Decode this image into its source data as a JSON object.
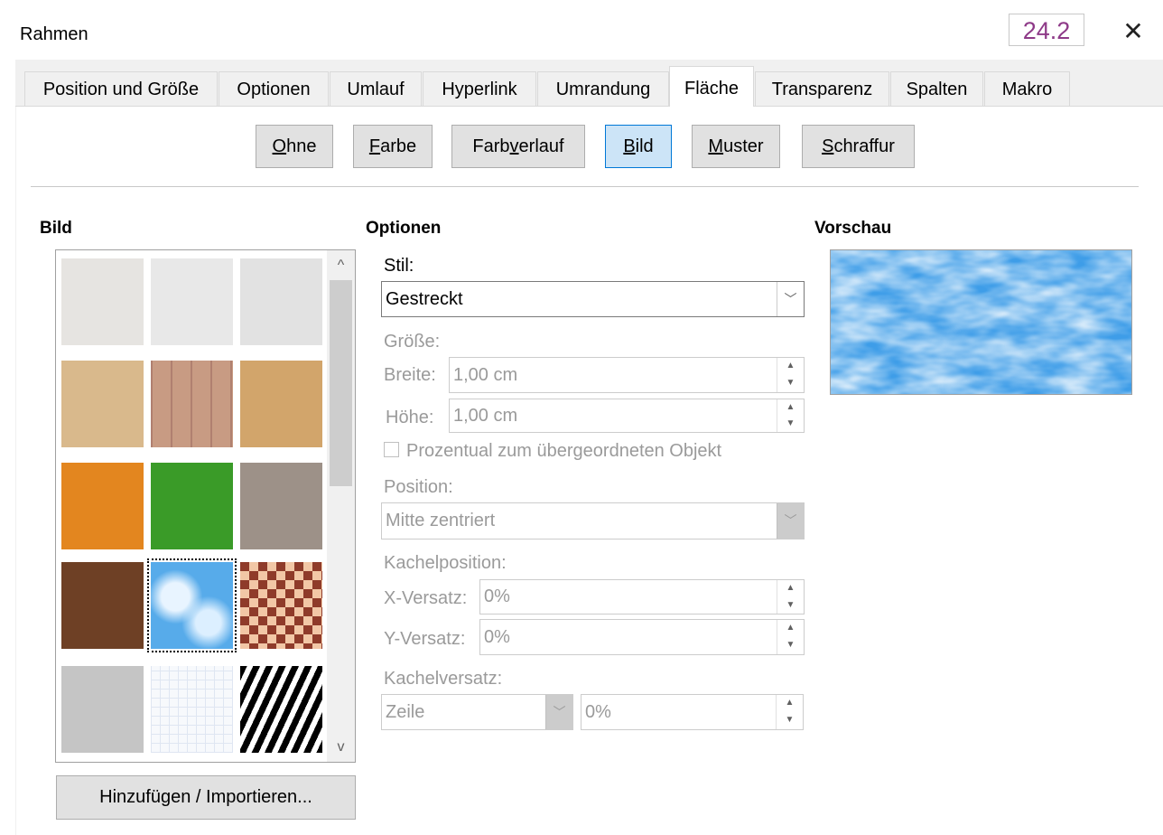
{
  "window": {
    "title": "Rahmen",
    "version": "24.2",
    "close_symbol": "✕"
  },
  "tabs": [
    {
      "label": "Position und Größe",
      "active": false
    },
    {
      "label": "Optionen",
      "active": false
    },
    {
      "label": "Umlauf",
      "active": false
    },
    {
      "label": "Hyperlink",
      "active": false
    },
    {
      "label": "Umrandung",
      "active": false
    },
    {
      "label": "Fläche",
      "active": true
    },
    {
      "label": "Transparenz",
      "active": false
    },
    {
      "label": "Spalten",
      "active": false
    },
    {
      "label": "Makro",
      "active": false
    }
  ],
  "fill_types": [
    {
      "label_pre": "",
      "label_u": "O",
      "label_post": "hne",
      "active": false
    },
    {
      "label_pre": "",
      "label_u": "F",
      "label_post": "arbe",
      "active": false
    },
    {
      "label_pre": "Farb",
      "label_u": "v",
      "label_post": "erlauf",
      "active": false
    },
    {
      "label_pre": "",
      "label_u": "B",
      "label_post": "ild",
      "active": true
    },
    {
      "label_pre": "",
      "label_u": "M",
      "label_post": "uster",
      "active": false
    },
    {
      "label_pre": "",
      "label_u": "S",
      "label_post": "chraffur",
      "active": false
    }
  ],
  "sections": {
    "bitmap": "Bild",
    "options": "Optionen",
    "preview": "Vorschau"
  },
  "gallery": {
    "selected_index": 10,
    "tiles": [
      {
        "name": "painted-white",
        "color": "#e6e4e1"
      },
      {
        "name": "paper-texture",
        "color": "#e8e8e8"
      },
      {
        "name": "paper-crumpled",
        "color": "#e2e2e2"
      },
      {
        "name": "paper-graph",
        "color": "#d9b98c"
      },
      {
        "name": "wooden-fence",
        "color": "#c89b83"
      },
      {
        "name": "cardboard",
        "color": "#d2a56b"
      },
      {
        "name": "maple-leaves",
        "color": "#e3861f"
      },
      {
        "name": "lawn",
        "color": "#3a9b28"
      },
      {
        "name": "pebbles",
        "color": "#9d9188"
      },
      {
        "name": "coffee-beans",
        "color": "#6e4025"
      },
      {
        "name": "sky",
        "color": "#57abea"
      },
      {
        "name": "mosaic",
        "color": "#c98a73"
      },
      {
        "name": "concrete",
        "color": "#c5c5c5"
      },
      {
        "name": "grid-paper",
        "color": "#f2f4f8"
      },
      {
        "name": "zebra",
        "color": "#777777"
      }
    ],
    "scroll_up": "^",
    "scroll_down": "v"
  },
  "import_button": "Hinzufügen / Importieren...",
  "options": {
    "style_label": "Stil:",
    "style_value": "Gestreckt",
    "size_label": "Größe:",
    "width_label": "Breite:",
    "width_value": "1,00 cm",
    "height_label": "Höhe:",
    "height_value": "1,00 cm",
    "relative_label": "Prozentual zum übergeordneten Objekt",
    "position_label": "Position:",
    "position_value": "Mitte zentriert",
    "tile_position_label": "Kachelposition:",
    "x_offset_label": "X-Versatz:",
    "x_offset_value": "0%",
    "y_offset_label": "Y-Versatz:",
    "y_offset_value": "0%",
    "tile_offset_label": "Kachelversatz:",
    "tile_offset_mode": "Zeile",
    "tile_offset_value": "0%"
  },
  "colors": {
    "active_tab_bg": "#ffffff",
    "active_button_bg": "#cce4f7",
    "active_button_border": "#0078d7",
    "version_color": "#8e3a88",
    "disabled_text": "#9a9a9a"
  }
}
